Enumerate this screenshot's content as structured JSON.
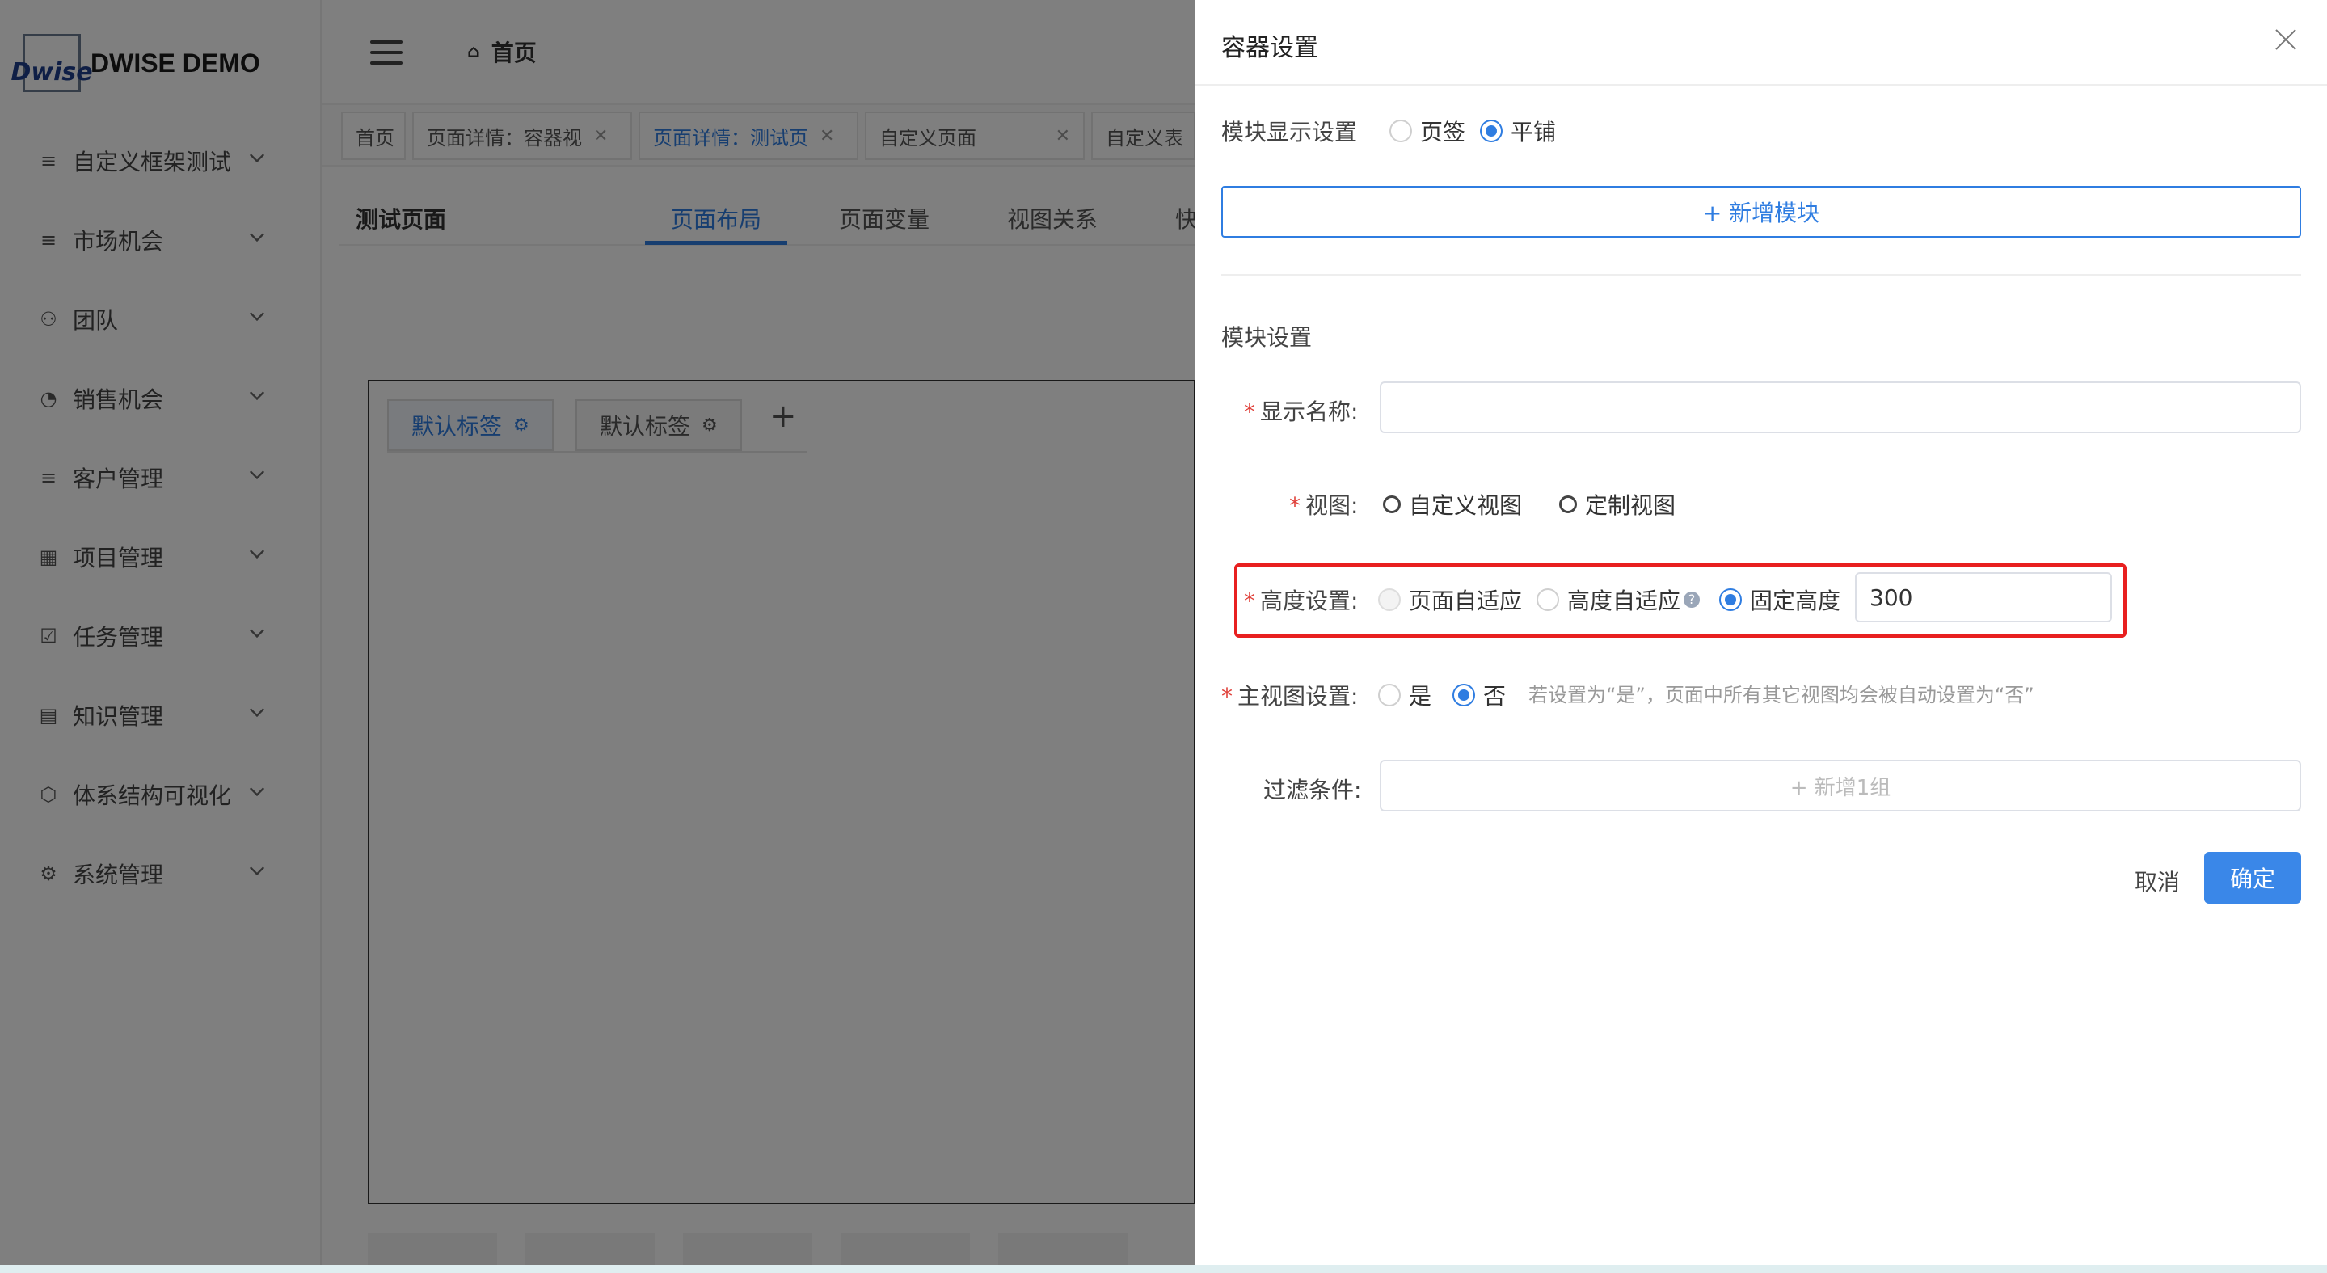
{
  "app": {
    "logo_mark": "Dwise",
    "logo_text": "DWISE DEMO",
    "breadcrumb": "首页"
  },
  "sidebar": {
    "items": [
      {
        "label": "自定义框架测试",
        "icon": "list-icon"
      },
      {
        "label": "市场机会",
        "icon": "list-icon"
      },
      {
        "label": "团队",
        "icon": "team-icon"
      },
      {
        "label": "销售机会",
        "icon": "pie-icon"
      },
      {
        "label": "客户管理",
        "icon": "list-icon"
      },
      {
        "label": "项目管理",
        "icon": "grid-icon"
      },
      {
        "label": "任务管理",
        "icon": "calendar-check-icon"
      },
      {
        "label": "知识管理",
        "icon": "book-icon"
      },
      {
        "label": "体系结构可视化",
        "icon": "hub-icon"
      },
      {
        "label": "系统管理",
        "icon": "gear-icon"
      }
    ]
  },
  "page_tabs": [
    {
      "label": "首页",
      "closable": false,
      "active": false
    },
    {
      "label": "页面详情：容器视",
      "closable": true,
      "active": false
    },
    {
      "label": "页面详情：测试页",
      "closable": true,
      "active": true
    },
    {
      "label": "自定义页面",
      "closable": true,
      "active": false
    },
    {
      "label": "自定义表",
      "closable": false,
      "active": false
    }
  ],
  "page_header": {
    "title": "测试页面",
    "tabs": [
      "页面布局",
      "页面变量",
      "视图关系",
      "快"
    ]
  },
  "canvas": {
    "tabs": [
      "默认标签",
      "默认标签"
    ],
    "add": "+"
  },
  "drawer": {
    "title": "容器设置",
    "display_mode": {
      "label": "模块显示设置",
      "options": [
        "页签",
        "平铺"
      ],
      "selected": "平铺"
    },
    "add_module_label": "+ 新增模块",
    "section_title": "模块设置",
    "display_name": {
      "label": "显示名称:",
      "value": ""
    },
    "view": {
      "label": "视图:",
      "options": [
        "自定义视图",
        "定制视图"
      ]
    },
    "height": {
      "label": "高度设置:",
      "options": [
        "页面自适应",
        "高度自适应",
        "固定高度"
      ],
      "selected": "固定高度",
      "value": "300"
    },
    "main_view": {
      "label": "主视图设置:",
      "options": [
        "是",
        "否"
      ],
      "selected": "否",
      "hint": "若设置为“是”，页面中所有其它视图均会被自动设置为“否”"
    },
    "filter": {
      "label": "过滤条件:",
      "add_label": "+ 新增1组"
    },
    "cancel_label": "取消",
    "ok_label": "确定"
  },
  "colors": {
    "primary": "#2f7de1",
    "required": "#e0403a",
    "highlight": "#e82020"
  }
}
